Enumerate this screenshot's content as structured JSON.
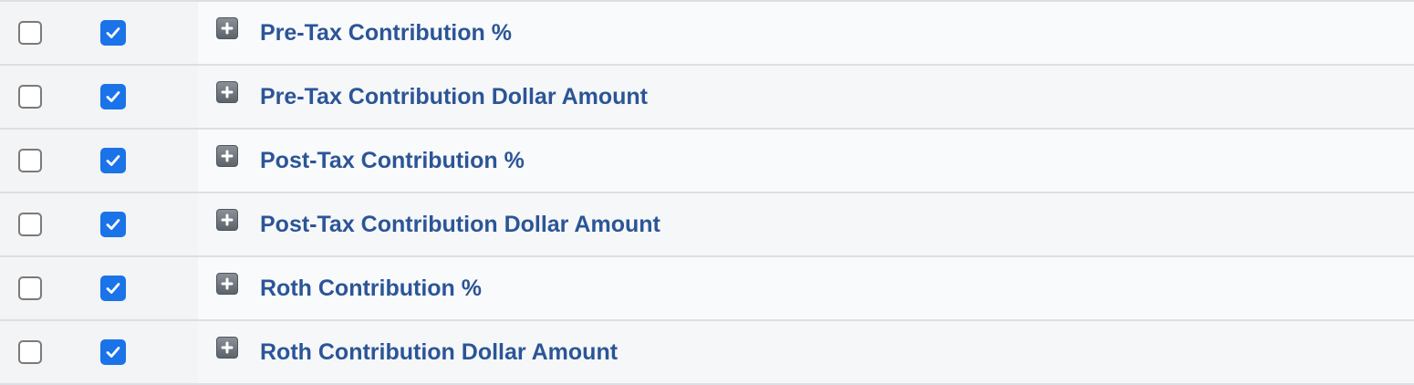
{
  "rows": [
    {
      "label": "Pre-Tax Contribution %",
      "select_checked": false,
      "visible_checked": true
    },
    {
      "label": "Pre-Tax Contribution Dollar Amount",
      "select_checked": false,
      "visible_checked": true
    },
    {
      "label": "Post-Tax Contribution %",
      "select_checked": false,
      "visible_checked": true
    },
    {
      "label": "Post-Tax Contribution Dollar Amount",
      "select_checked": false,
      "visible_checked": true
    },
    {
      "label": "Roth Contribution %",
      "select_checked": false,
      "visible_checked": true
    },
    {
      "label": "Roth Contribution Dollar Amount",
      "select_checked": false,
      "visible_checked": true
    }
  ],
  "colors": {
    "accent": "#1a73e8",
    "label": "#2b5597"
  },
  "icons": {
    "expand": "plus-expand-icon",
    "check": "checkmark-icon"
  }
}
